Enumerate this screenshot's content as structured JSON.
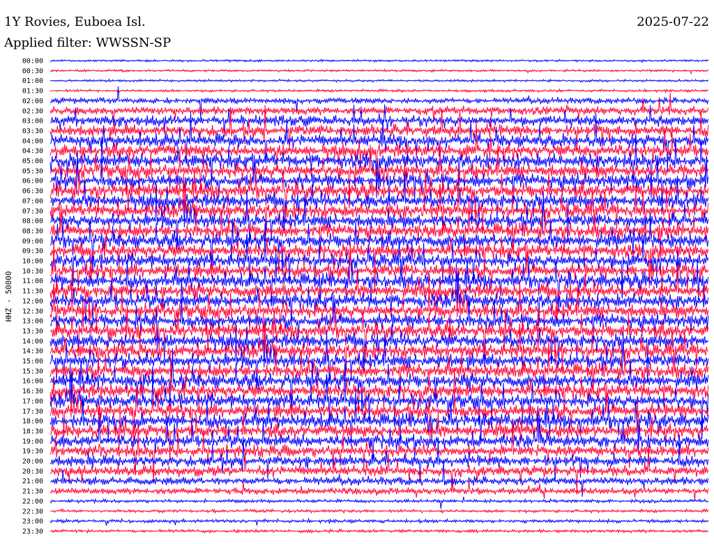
{
  "chart_data": {
    "type": "line",
    "title": "1Y Rovies, Euboea Isl.",
    "subtitle": "Applied filter: WWSSN-SP",
    "date": "2025-07-22",
    "ylabel": "HHZ - 50000",
    "row_labels": [
      "00:00",
      "00:30",
      "01:00",
      "01:30",
      "02:00",
      "02:30",
      "03:00",
      "03:30",
      "04:00",
      "04:30",
      "05:00",
      "05:30",
      "06:00",
      "06:30",
      "07:00",
      "07:30",
      "08:00",
      "08:30",
      "09:00",
      "09:30",
      "10:00",
      "10:30",
      "11:00",
      "11:30",
      "12:00",
      "12:30",
      "13:00",
      "13:30",
      "14:00",
      "14:30",
      "15:00",
      "15:30",
      "16:00",
      "16:30",
      "17:00",
      "17:30",
      "18:00",
      "18:30",
      "19:00",
      "19:30",
      "20:00",
      "20:30",
      "21:00",
      "21:30",
      "22:00",
      "22:30",
      "23:00",
      "23:30"
    ],
    "series_colors": [
      "#0000ff",
      "#ff0033"
    ],
    "grid": false,
    "activity_level": [
      0.04,
      0.05,
      0.05,
      0.08,
      0.35,
      0.55,
      0.75,
      0.85,
      0.9,
      0.95,
      1.0,
      1.0,
      1.0,
      1.0,
      1.0,
      1.0,
      1.0,
      1.0,
      1.0,
      1.0,
      1.0,
      1.0,
      1.0,
      1.0,
      1.0,
      1.0,
      1.0,
      1.0,
      1.0,
      1.0,
      1.0,
      1.0,
      1.0,
      1.0,
      1.0,
      1.0,
      1.0,
      0.95,
      0.9,
      0.85,
      0.8,
      0.7,
      0.55,
      0.4,
      0.15,
      0.12,
      0.15,
      0.12
    ]
  }
}
